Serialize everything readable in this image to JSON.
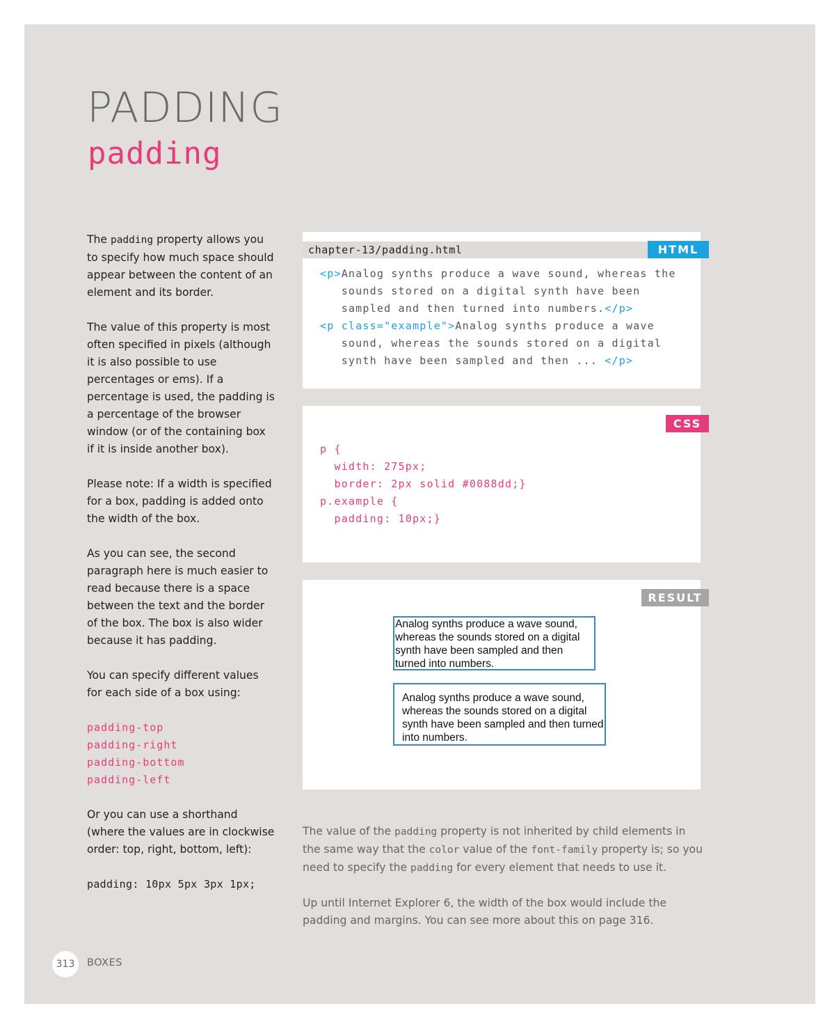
{
  "header": {
    "title": "PADDING",
    "subtitle": "padding"
  },
  "intro": {
    "p1_before": "The ",
    "p1_code": "padding",
    "p1_after": " property allows you to specify how much space should appear between the content of an element and its border.",
    "p2": "The value of this property is most often specified in pixels (although it is also possible to use percentages or ems). If a percentage is used, the padding is a percentage of the browser window (or of the containing box if it is inside another box).",
    "p3": "Please note: If a width is specified for a box, padding is added onto the width of the box.",
    "p4": "As you can see, the second paragraph here is much easier to read because there is a space between the text and the border of the box. The box is also wider because it has padding.",
    "p5": "You can specify different values for each side of a box using:",
    "properties": [
      "padding-top",
      "padding-right",
      "padding-bottom",
      "padding-left"
    ],
    "p6": "Or you can use a shorthand (where the values are in clockwise order: top, right, bottom, left):",
    "shorthand": "padding: 10px 5px 3px 1px;"
  },
  "html_panel": {
    "filename": "chapter-13/padding.html",
    "tag": "HTML",
    "lines": [
      {
        "t1": "<p>",
        "text": "Analog synths produce a wave sound, whereas the",
        "t2": ""
      },
      {
        "t1": "",
        "text": "   sounds stored on a digital synth have been",
        "t2": ""
      },
      {
        "t1": "",
        "text": "   sampled and then turned into numbers.",
        "t2": "</p>"
      },
      {
        "t1": "<p class=\"example\">",
        "text": "Analog synths produce a wave",
        "t2": ""
      },
      {
        "t1": "",
        "text": "   sound, whereas the sounds stored on a digital",
        "t2": ""
      },
      {
        "t1": "",
        "text": "   synth have been sampled and then ... ",
        "t2": "</p>"
      }
    ]
  },
  "css_panel": {
    "tag": "CSS",
    "code": "p {\n  width: 275px;\n  border: 2px solid #0088dd;}\np.example {\n  padding: 10px;}"
  },
  "result_panel": {
    "tag": "RESULT",
    "box1": "Analog synths produce a wave sound, whereas the sounds stored on a digital synth have been sampled and then turned into numbers.",
    "box2": "Analog synths produce a wave sound, whereas the sounds stored on a digital synth have been sampled and then turned into numbers."
  },
  "notes": {
    "n1_a": "The value of the ",
    "n1_code1": "padding",
    "n1_b": " property is not inherited by child elements in the same way that the ",
    "n1_code2": "color",
    "n1_c": " value of the ",
    "n1_code3": "font-family",
    "n1_d": " property is; so you need to specify the ",
    "n1_code4": "padding",
    "n1_e": " for every element that needs to use it.",
    "n2": "Up until Internet Explorer 6, the width of the box would include the padding and margins. You can see more about this on page 316."
  },
  "footer": {
    "page_number": "313",
    "section": "BOXES"
  },
  "colors": {
    "page_bg": "#e1dedb",
    "accent_pink": "#e33d7c",
    "accent_blue": "#1aa3df",
    "result_gray": "#a5a4a6",
    "demo_border": "#3a86c8"
  }
}
